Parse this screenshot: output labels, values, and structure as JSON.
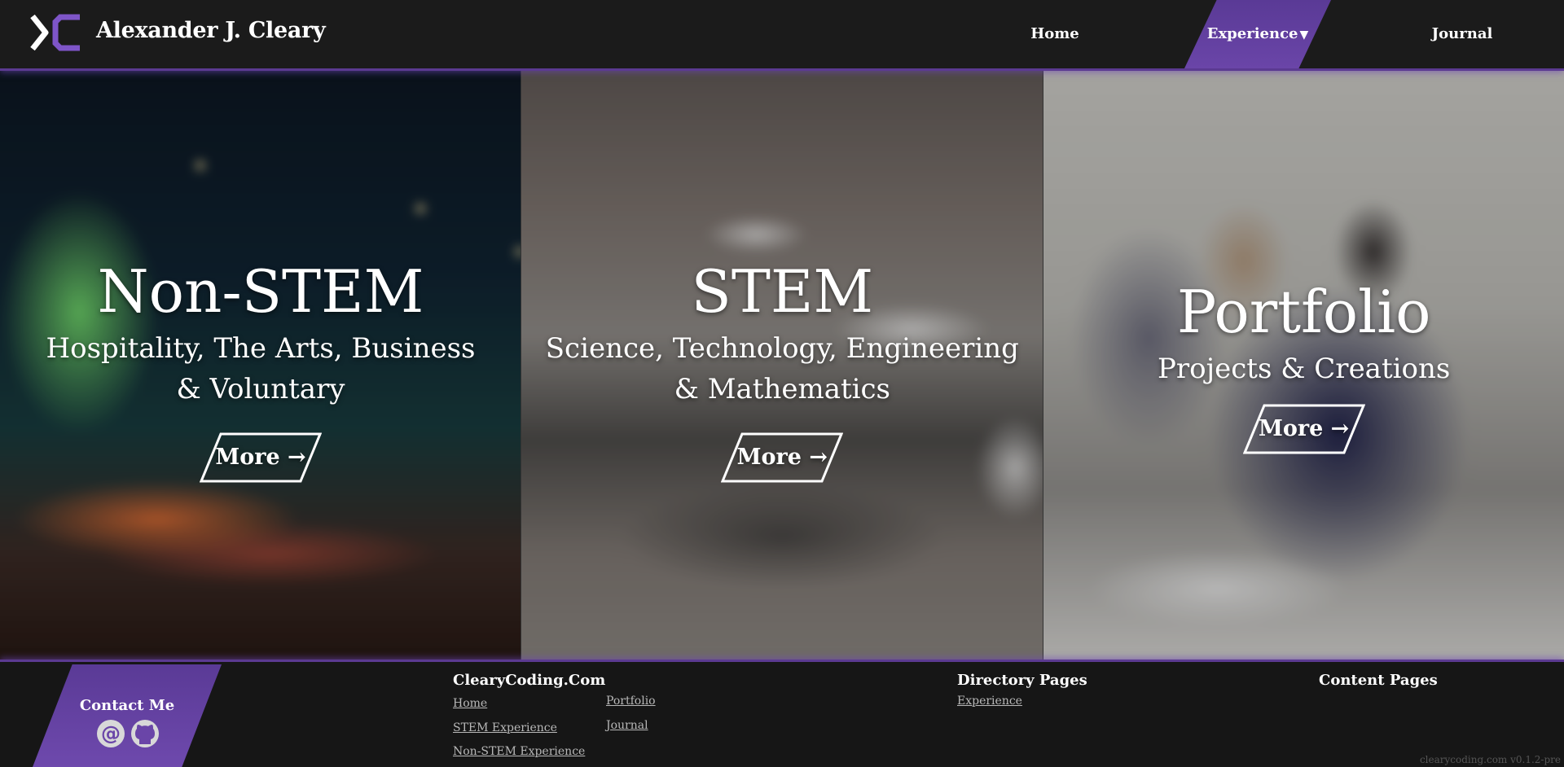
{
  "header": {
    "site_name": "Alexander J. Cleary",
    "nav": {
      "home": "Home",
      "experience": "Experience",
      "journal": "Journal"
    },
    "accent_color": "#5b3a91"
  },
  "panels": [
    {
      "title": "Non-STEM",
      "subtitle": "Hospitality, The Arts, Business & Voluntary",
      "button": "More →"
    },
    {
      "title": "STEM",
      "subtitle": "Science, Technology, Engineering & Mathematics",
      "button": "More →"
    },
    {
      "title": "Portfolio",
      "subtitle": "Projects & Creations",
      "button": "More →"
    }
  ],
  "footer": {
    "contact": {
      "label": "Contact Me",
      "icons": [
        "at-sign-icon",
        "github-icon"
      ]
    },
    "site_column": {
      "heading": "ClearyCoding.Com",
      "links": [
        "Home",
        "STEM Experience",
        "Non-STEM Experience",
        "Portfolio",
        "Journal"
      ]
    },
    "directory_column": {
      "heading": "Directory Pages",
      "links": [
        "Experience"
      ]
    },
    "content_column": {
      "heading": "Content Pages"
    },
    "version": "clearycoding.com v0.1.2-pre"
  }
}
